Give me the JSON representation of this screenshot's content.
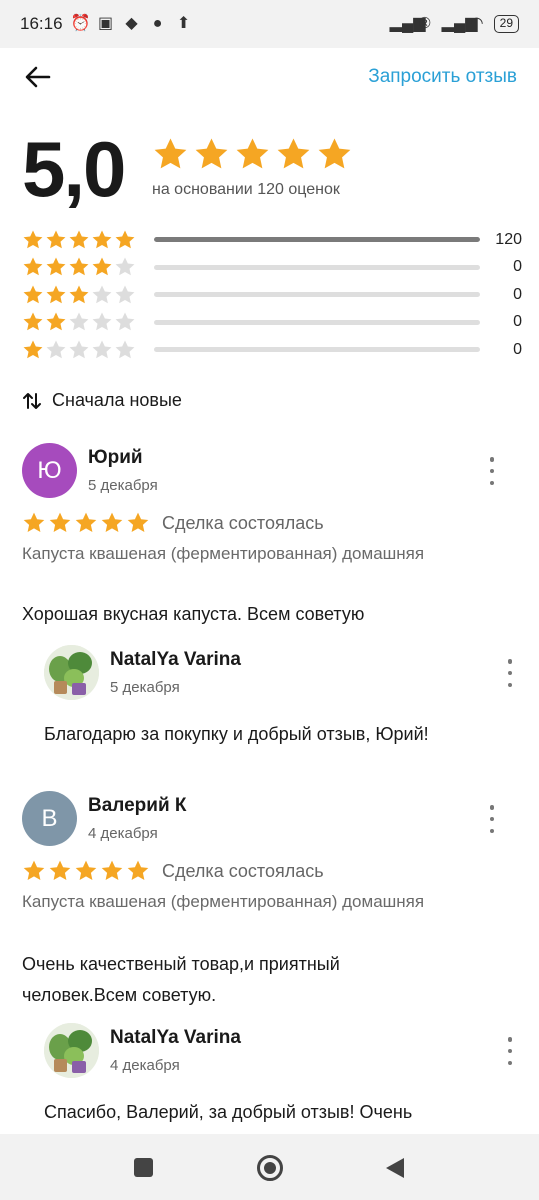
{
  "status_bar": {
    "time": "16:16",
    "battery": "29",
    "left_icons": [
      "alarm-icon",
      "nfc-icon",
      "diamond-icon",
      "chat-icon",
      "upload-icon"
    ],
    "right_icons": [
      "signal-icon",
      "registered-icon",
      "signal-icon",
      "wifi-icon"
    ]
  },
  "header": {
    "request_review": "Запросить отзыв"
  },
  "summary": {
    "rating": "5,0",
    "stars": 5,
    "based_on": "на основании 120 оценок",
    "distribution": [
      {
        "stars": 5,
        "count": "120",
        "fraction": 1.0
      },
      {
        "stars": 4,
        "count": "0",
        "fraction": 0
      },
      {
        "stars": 3,
        "count": "0",
        "fraction": 0
      },
      {
        "stars": 2,
        "count": "0",
        "fraction": 0
      },
      {
        "stars": 1,
        "count": "0",
        "fraction": 0
      }
    ]
  },
  "sort": {
    "label": "Сначала новые"
  },
  "reviews": [
    {
      "initial": "Ю",
      "avatar_color": "#a64bbd",
      "author": "Юрий",
      "date": "5 декабря",
      "stars": 5,
      "deal": "Сделка состоялась",
      "product": "Капуста квашеная (ферментированная) домашняя",
      "text": "Хорошая вкусная капуста. Всем советую",
      "reply": {
        "author": "NatalYa Varina",
        "date": "5 декабря",
        "text": "Благодарю за покупку и добрый отзыв, Юрий!"
      }
    },
    {
      "initial": "В",
      "avatar_color": "#7f96a8",
      "author": "Валерий К",
      "date": "4 декабря",
      "stars": 5,
      "deal": "Сделка состоялась",
      "product": "Капуста квашеная (ферментированная) домашняя",
      "text": "Очень качественый товар,и приятный человек.Всем советую.",
      "reply": {
        "author": "NatalYa Varina",
        "date": "4 декабря",
        "text": "Спасибо, Валерий, за добрый отзыв! Очень"
      }
    }
  ],
  "colors": {
    "accent": "#2aa0d6",
    "star": "#f5a623",
    "star_empty": "#dddddd"
  }
}
